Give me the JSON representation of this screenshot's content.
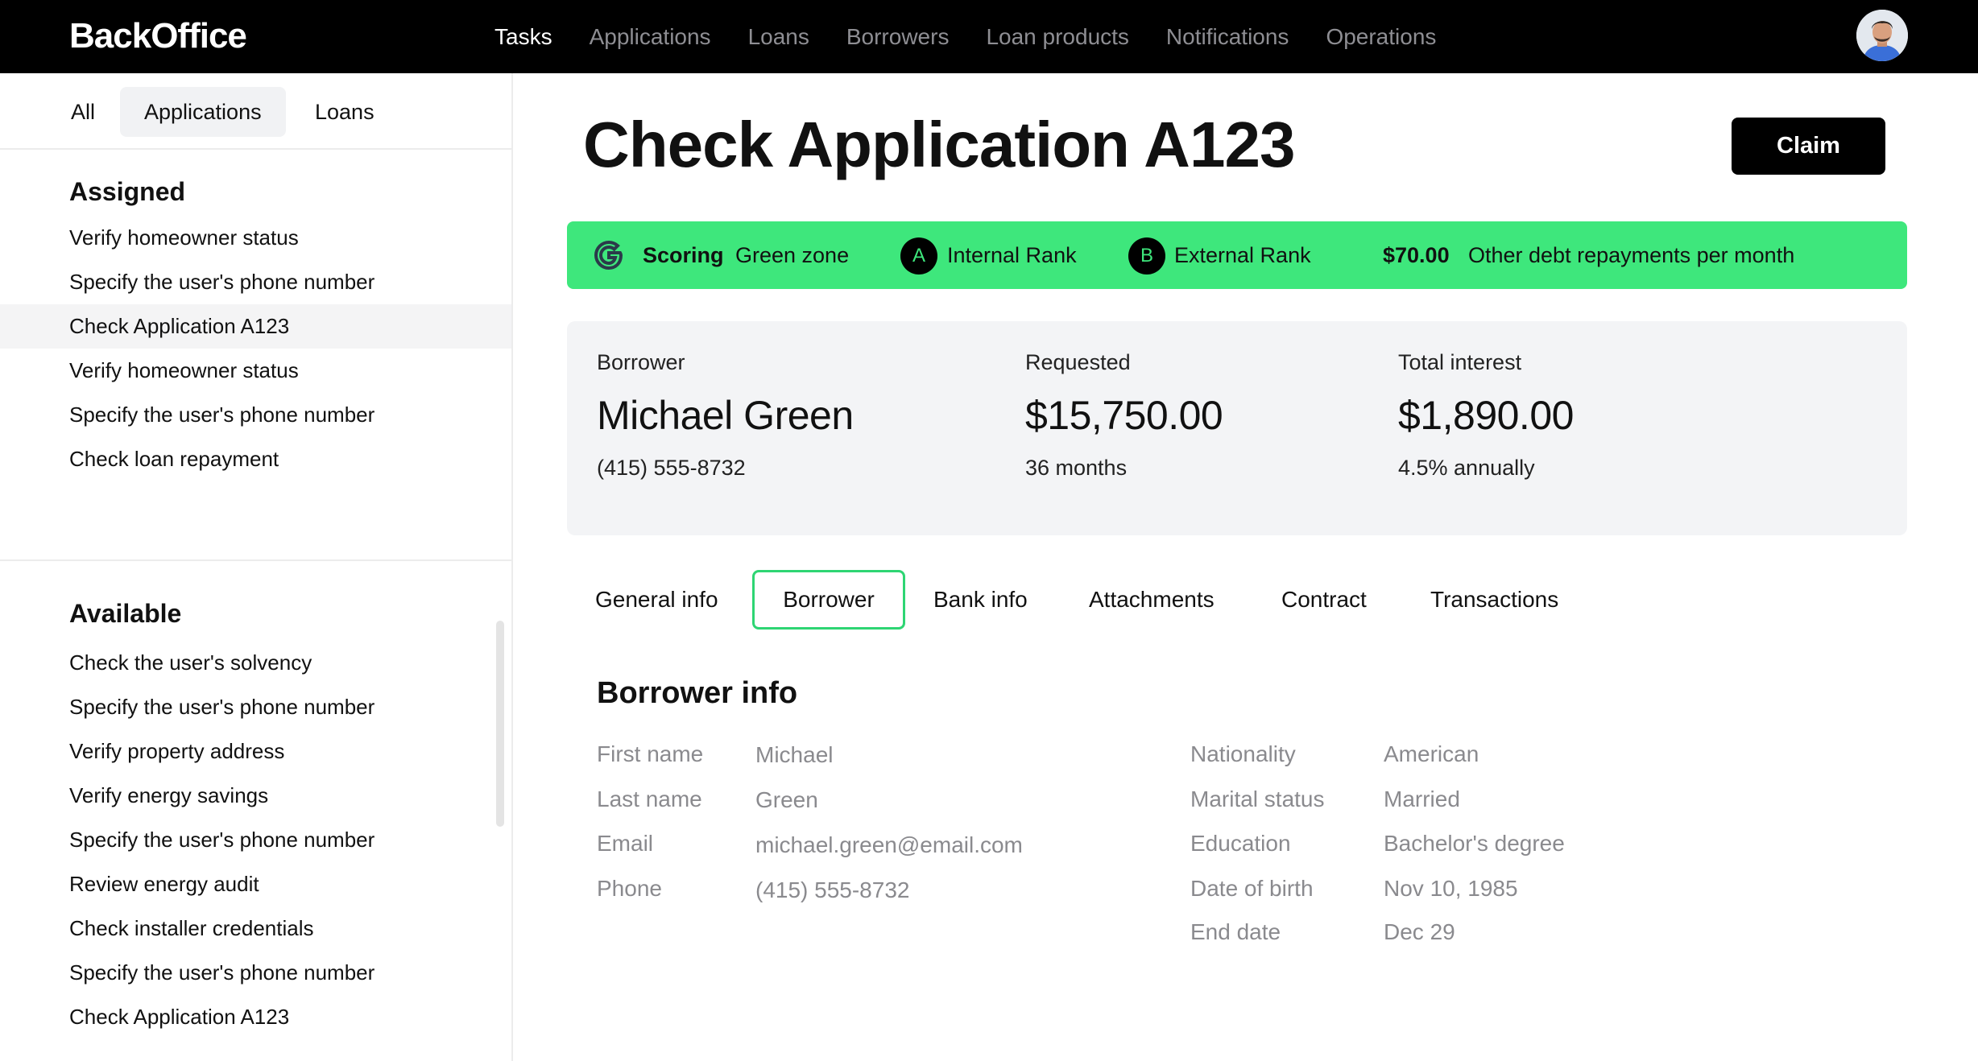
{
  "header": {
    "brand": "BackOffice",
    "nav": [
      "Tasks",
      "Applications",
      "Loans",
      "Borrowers",
      "Loan products",
      "Notifications",
      "Operations"
    ],
    "active_nav": "Tasks"
  },
  "sidebar": {
    "segments": [
      "All",
      "Applications",
      "Loans"
    ],
    "active_segment": "Applications",
    "assigned": {
      "title": "Assigned",
      "items": [
        "Verify homeowner status",
        "Specify the user's phone number",
        "Check Application A123",
        "Verify homeowner status",
        "Specify the user's phone number",
        "Check loan repayment"
      ],
      "selected_index": 2
    },
    "available": {
      "title": "Available",
      "items": [
        "Check the user's solvency",
        "Specify the user's phone number",
        "Verify property address",
        "Verify energy savings",
        "Specify the user's phone number",
        "Review energy audit",
        "Check installer credentials",
        "Specify the user's phone number",
        "Check Application A123"
      ]
    }
  },
  "main": {
    "title": "Check Application A123",
    "claim_label": "Claim",
    "scoring": {
      "label": "Scoring",
      "zone": "Green zone",
      "internal_rank_letter": "A",
      "internal_rank_label": "Internal Rank",
      "external_rank_letter": "B",
      "external_rank_label": "External Rank",
      "debt_amount": "$70.00",
      "debt_label": "Other debt repayments per month"
    },
    "summary": {
      "borrower": {
        "label": "Borrower",
        "value": "Michael Green",
        "sub": "(415) 555-8732"
      },
      "requested": {
        "label": "Requested",
        "value": "$15,750.00",
        "sub": "36 months"
      },
      "interest": {
        "label": "Total interest",
        "value": "$1,890.00",
        "sub": "4.5% annually"
      }
    },
    "tabs": [
      "General info",
      "Borrower",
      "Bank info",
      "Attachments",
      "Contract",
      "Transactions"
    ],
    "active_tab": "Borrower",
    "borrower_info": {
      "title": "Borrower info",
      "left": [
        {
          "label": "First name",
          "value": "Michael"
        },
        {
          "label": "Last name",
          "value": "Green"
        },
        {
          "label": "Email",
          "value": "michael.green@email.com"
        },
        {
          "label": "Phone",
          "value": "(415) 555-8732"
        }
      ],
      "right": [
        {
          "label": "Nationality",
          "value": "American"
        },
        {
          "label": "Marital status",
          "value": "Married"
        },
        {
          "label": "Education",
          "value": "Bachelor's degree"
        },
        {
          "label": "Date of birth",
          "value": "Nov 10, 1985"
        },
        {
          "label": "End date",
          "value": "Dec 29"
        }
      ]
    }
  },
  "colors": {
    "topbar": "#000000",
    "accent_green": "#3ee77c",
    "tab_border": "#2ed573",
    "muted_text": "#8a8a8e"
  },
  "icons": {
    "scoring": "google-g-icon",
    "avatar": "user-avatar"
  }
}
